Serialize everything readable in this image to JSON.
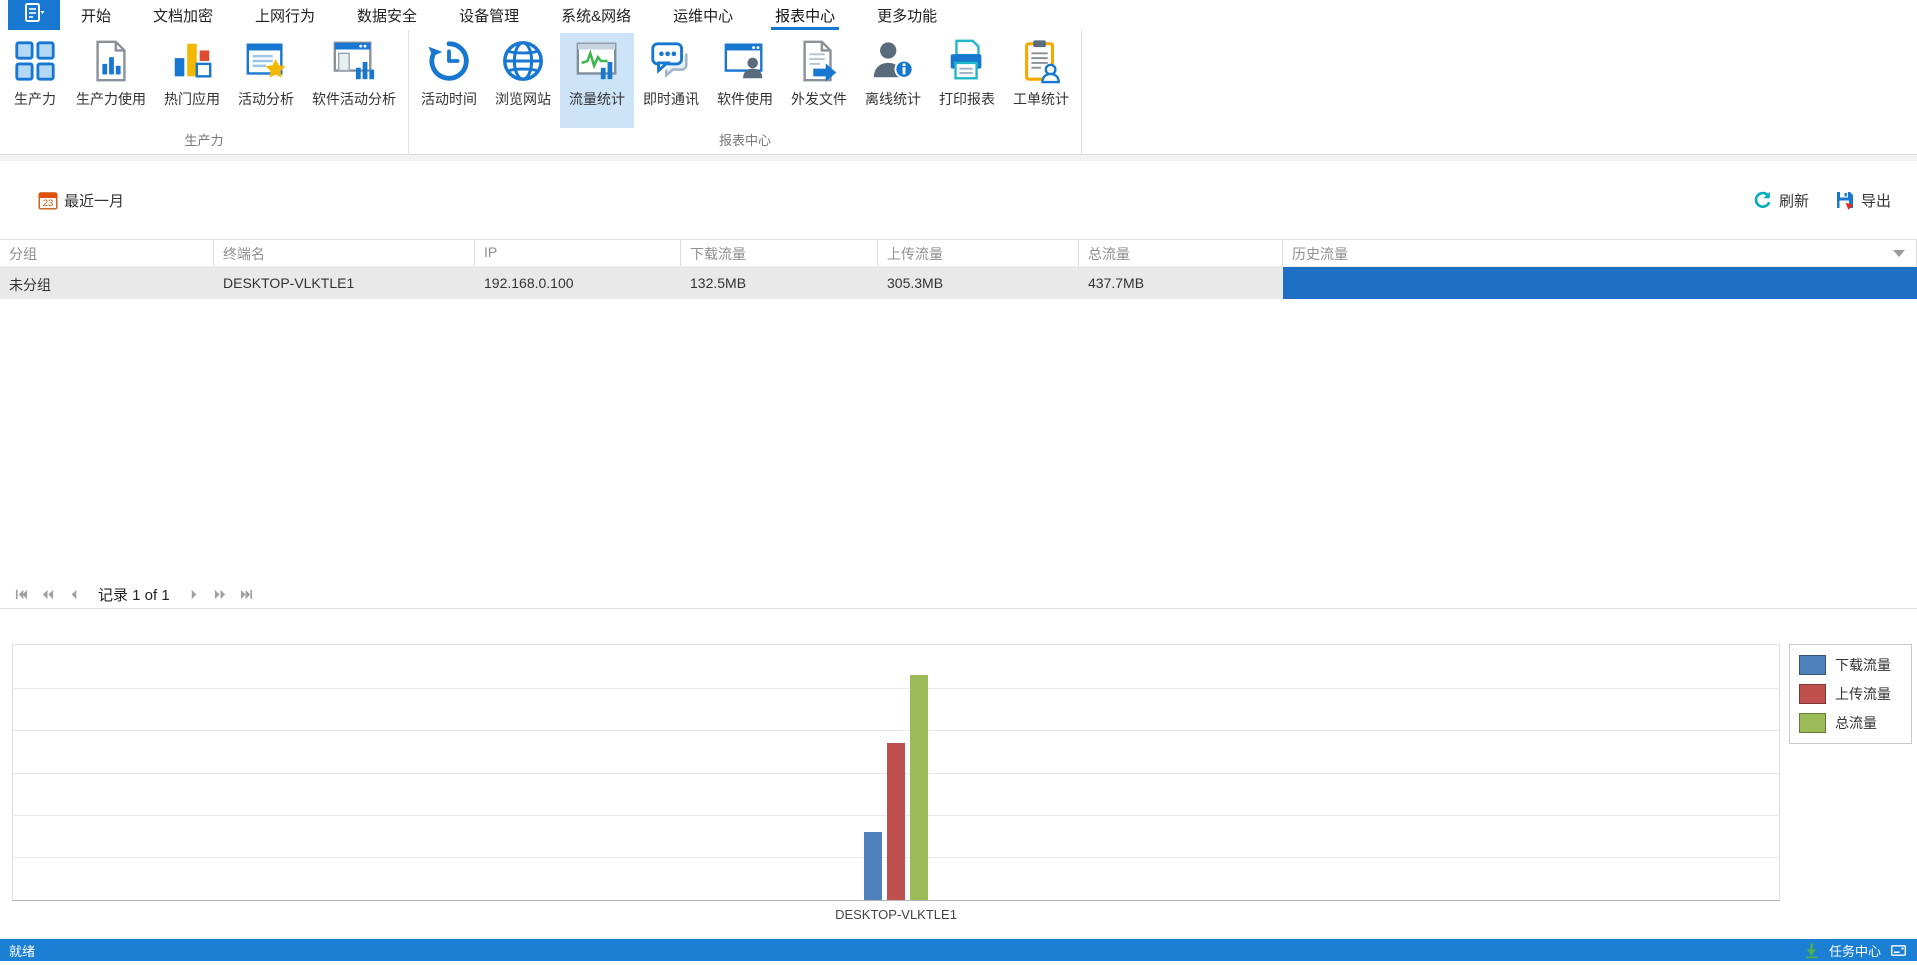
{
  "tabs": {
    "selected_key": "report-center",
    "items": [
      {
        "key": "start",
        "label": "开始"
      },
      {
        "key": "doc-encryption",
        "label": "文档加密"
      },
      {
        "key": "web-behavior",
        "label": "上网行为"
      },
      {
        "key": "data-security",
        "label": "数据安全"
      },
      {
        "key": "device-mgmt",
        "label": "设备管理"
      },
      {
        "key": "system-network",
        "label": "系统&网络"
      },
      {
        "key": "ops-center",
        "label": "运维中心"
      },
      {
        "key": "report-center",
        "label": "报表中心"
      },
      {
        "key": "more-features",
        "label": "更多功能"
      }
    ]
  },
  "ribbon": {
    "selected_key": "traffic-stats",
    "groups": [
      {
        "label": "生产力",
        "buttons": [
          {
            "key": "productivity",
            "label": "生产力",
            "icon": "productivity-grid-icon"
          },
          {
            "key": "productivity-usage",
            "label": "生产力使用",
            "icon": "doc-bar-chart-icon"
          },
          {
            "key": "top-apps",
            "label": "热门应用",
            "icon": "top-apps-chart-icon"
          },
          {
            "key": "activity-analysis",
            "label": "活动分析",
            "icon": "doc-star-icon"
          },
          {
            "key": "software-activity-analysis",
            "label": "软件活动分析",
            "icon": "window-bar-chart-icon"
          }
        ]
      },
      {
        "label": "报表中心",
        "buttons": [
          {
            "key": "activity-time",
            "label": "活动时间",
            "icon": "history-clock-icon"
          },
          {
            "key": "web-browsing",
            "label": "浏览网站",
            "icon": "globe-icon"
          },
          {
            "key": "traffic-stats",
            "label": "流量统计",
            "icon": "traffic-stats-icon"
          },
          {
            "key": "instant-messaging",
            "label": "即时通讯",
            "icon": "chat-icon"
          },
          {
            "key": "software-usage",
            "label": "软件使用",
            "icon": "window-user-icon"
          },
          {
            "key": "outgoing-files",
            "label": "外发文件",
            "icon": "outgoing-file-icon"
          },
          {
            "key": "offline-stats",
            "label": "离线统计",
            "icon": "offline-user-icon"
          },
          {
            "key": "print-report",
            "label": "打印报表",
            "icon": "printer-icon"
          },
          {
            "key": "work-order-stats",
            "label": "工单统计",
            "icon": "clipboard-user-icon"
          }
        ]
      }
    ]
  },
  "toolbar": {
    "date_filter": {
      "label": "最近一月",
      "icon": "calendar-icon"
    },
    "refresh": {
      "label": "刷新",
      "icon": "refresh-icon"
    },
    "export": {
      "label": "导出",
      "icon": "export-icon"
    }
  },
  "table": {
    "columns": [
      {
        "key": "group",
        "label": "分组"
      },
      {
        "key": "terminal",
        "label": "终端名"
      },
      {
        "key": "ip",
        "label": "IP"
      },
      {
        "key": "download",
        "label": "下载流量"
      },
      {
        "key": "upload",
        "label": "上传流量"
      },
      {
        "key": "total",
        "label": "总流量"
      },
      {
        "key": "history",
        "label": "历史流量"
      }
    ],
    "rows": [
      {
        "group": "未分组",
        "terminal": "DESKTOP-VLKTLE1",
        "ip": "192.168.0.100",
        "download": "132.5MB",
        "upload": "305.3MB",
        "total": "437.7MB",
        "history_bar_color": "#1f6fc5"
      }
    ]
  },
  "pager": {
    "record_label": "记录 1 of 1"
  },
  "chart_data": {
    "type": "bar",
    "categories": [
      "DESKTOP-VLKTLE1"
    ],
    "series": [
      {
        "name": "下载流量",
        "values": [
          132.5
        ],
        "color": "#4f81bd"
      },
      {
        "name": "上传流量",
        "values": [
          305.3
        ],
        "color": "#c0504d"
      },
      {
        "name": "总流量",
        "values": [
          437.7
        ],
        "color": "#9bbb59"
      }
    ],
    "unit": "MB",
    "ylim": [
      0,
      500
    ],
    "grid": true,
    "legend_position": "top-right",
    "title": "",
    "xlabel": "",
    "ylabel": ""
  },
  "statusbar": {
    "ready": "就绪",
    "task_center": "任务中心",
    "accent_color": "#1b7fd4"
  }
}
